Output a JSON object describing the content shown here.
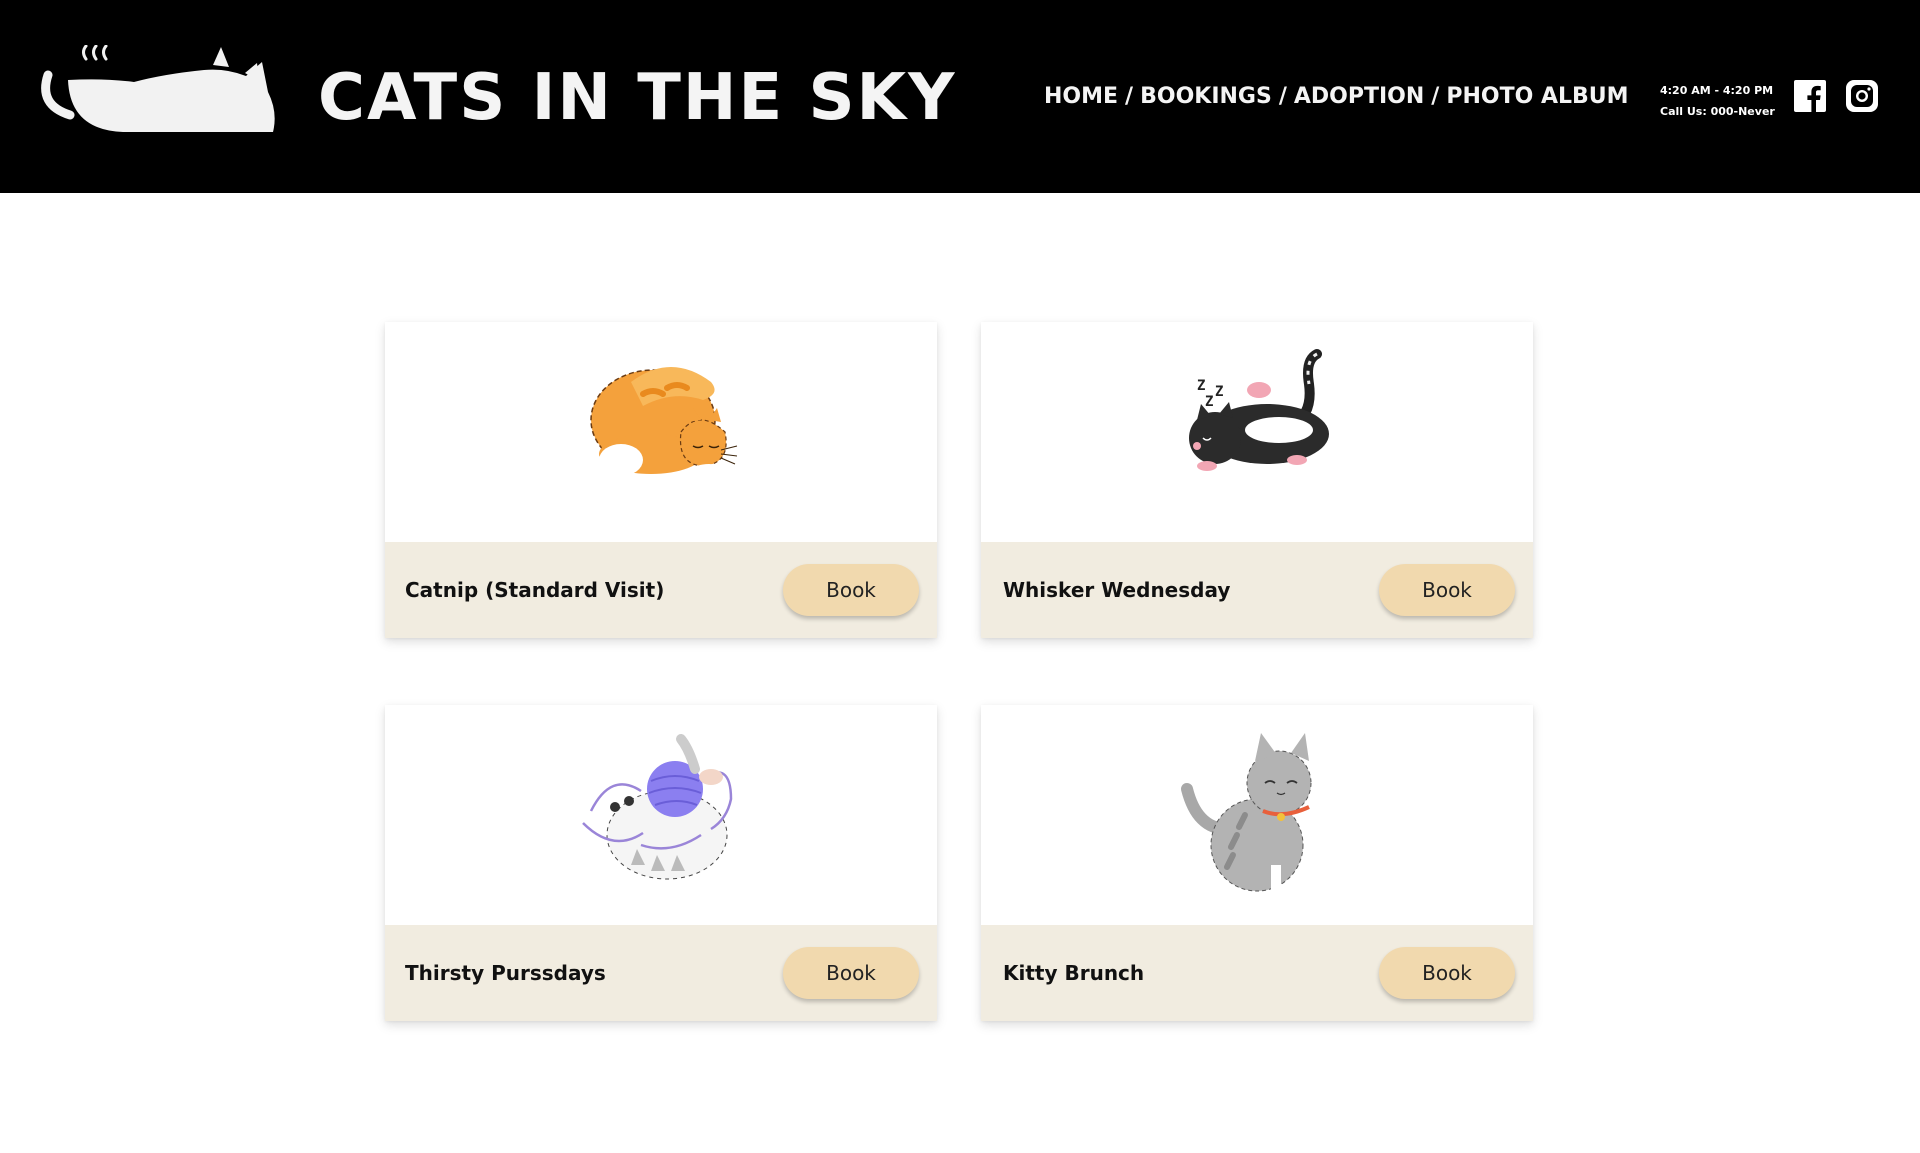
{
  "header": {
    "site_title": "CATS IN THE SKY",
    "logo_icon": "cat-teacup-logo-icon",
    "nav": [
      {
        "label": "HOME"
      },
      {
        "label": "BOOKINGS"
      },
      {
        "label": "ADOPTION"
      },
      {
        "label": "PHOTO ALBUM"
      }
    ],
    "nav_separator": "/",
    "hours": "4:20 AM - 4:20 PM",
    "phone": "Call Us: 000-Never",
    "social": [
      {
        "icon": "facebook-icon"
      },
      {
        "icon": "instagram-icon"
      }
    ]
  },
  "cards": [
    {
      "name": "Catnip (Standard Visit)",
      "button": "Book",
      "image_icon": "orange-cat-stretching-icon"
    },
    {
      "name": "Whisker Wednesday",
      "button": "Book",
      "image_icon": "sleeping-tuxedo-cat-icon"
    },
    {
      "name": "Thirsty Purssdays",
      "button": "Book",
      "image_icon": "cat-playing-yarn-icon"
    },
    {
      "name": "Kitty Brunch",
      "button": "Book",
      "image_icon": "gray-tabby-cat-icon"
    }
  ],
  "colors": {
    "header_bg": "#000000",
    "card_footer_bg": "#f1ece0",
    "button_bg": "#f1d9ae"
  }
}
